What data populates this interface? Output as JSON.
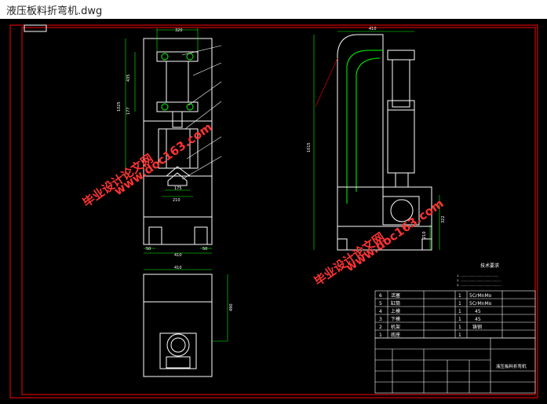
{
  "window": {
    "title": "液压板料折弯机.dwg"
  },
  "drawing": {
    "watermark_text_1": "毕业设计论文网",
    "watermark_url_1": "www.doc163.com",
    "watermark_text_2": "毕业设计论文网",
    "watermark_url_2": "www.doc163.com",
    "notes_title": "技术要求",
    "notes": [
      "1. ............................................",
      "2. ...............................................",
      "3. ..............................................."
    ],
    "bom_rows": [
      {
        "no": "6",
        "name": "活塞",
        "qty": "1",
        "material": "5CrMnMo"
      },
      {
        "no": "5",
        "name": "缸筒",
        "qty": "1",
        "material": "5CrMnMo"
      },
      {
        "no": "4",
        "name": "上模",
        "qty": "1",
        "material": "45"
      },
      {
        "no": "3",
        "name": "下模",
        "qty": "1",
        "material": "45"
      },
      {
        "no": "2",
        "name": "机架",
        "qty": "1",
        "material": "铸钢"
      },
      {
        "no": "1",
        "name": "底座",
        "qty": "1",
        "material": ""
      }
    ],
    "title_block_name": "液压板料折弯机",
    "dim_top_width": "320",
    "dim_side_width": "410",
    "dim_height": "1025",
    "dim_front_width": "410",
    "dim_base_left": "50",
    "dim_base_right": "50",
    "dim_die": "210",
    "dim_die_inner": "175",
    "dim_plan_height": "490",
    "dim_side_total": "1015",
    "dim_side_right": "322",
    "dim_side_low": "210",
    "dim_upper": "435",
    "dim_mid": "177"
  },
  "colors": {
    "frame": "#ff0000",
    "lines": "#ffffff",
    "watermark": "#ff3333",
    "green": "#00ff00",
    "yellow": "#ffff00"
  }
}
